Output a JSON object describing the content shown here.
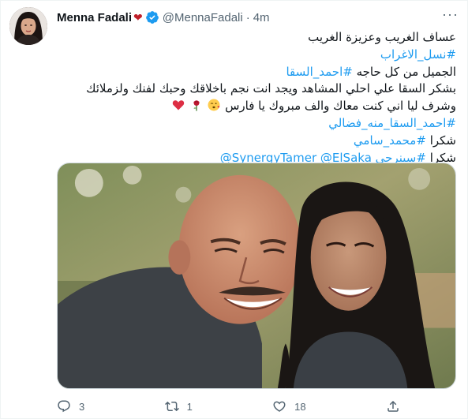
{
  "tweet": {
    "author_name": "Menna Fadali",
    "author_badge": "❤",
    "handle": "@MennaFadali",
    "separator": "·",
    "time": "4m",
    "more_label": "···",
    "lines": {
      "l1": "عساف الغريب وعزيزة الغريب",
      "l2_tag": "#نسل_الاغراب",
      "l3_text": "الجميل من كل حاجه ",
      "l3_tag": "#احمد_السقا",
      "l4": "بشكر السقا علي احلي المشاهد ويجد انت نجم باخلاقك وحبك لفنك ولزملائك",
      "l5_text": "وشرف ليا اني كنت معاك والف مبروك يا فارس",
      "l6_tag": "#احمد_السقا_منه_فضالي",
      "l7_text": "شكرا ",
      "l7_tag": "#محمد_سامي",
      "l8_text": "شكرا ",
      "l8_tag": "#سينرجي",
      "l8_mention1": "@ElSaka",
      "l8_mention2": "@SynergyTamer"
    },
    "actions": {
      "reply_count": "3",
      "retweet_count": "1",
      "like_count": "18"
    }
  },
  "colors": {
    "link": "#1d9bf0",
    "muted": "#536471",
    "verified": "#1d9bf0",
    "heart": "#c0202a"
  },
  "icons": [
    "verified-badge-icon",
    "more-icon",
    "kiss-emoji-icon",
    "rose-emoji-icon",
    "red-heart-emoji-icon",
    "reply-icon",
    "retweet-icon",
    "like-icon",
    "share-icon"
  ]
}
